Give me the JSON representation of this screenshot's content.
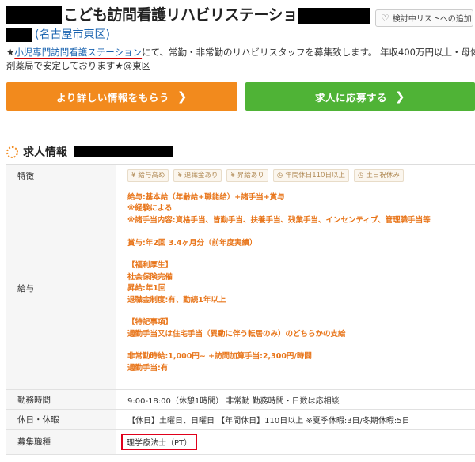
{
  "header": {
    "title": "こども訪問看護リハビリステーション",
    "fav_label": "検討中リストへの追加",
    "location": "(名古屋市東区)"
  },
  "intro": {
    "prefix": "★",
    "highlight": "小児専門訪問看護ステーション",
    "line1_rest": "にて、常勤・非常勤のリハビリスタッフを募集致します。 年収400万円以上・母体は調",
    "line2": "剤薬局で安定しております★@東区"
  },
  "buttons": {
    "info": "より詳しい情報をもらう",
    "apply": "求人に応募する"
  },
  "section": {
    "title": "求人情報"
  },
  "table": {
    "features_label": "特徴",
    "features": [
      {
        "icon": "yen-icon",
        "glyph": "¥",
        "label": "給与高め"
      },
      {
        "icon": "yen-icon",
        "glyph": "¥",
        "label": "退職金あり"
      },
      {
        "icon": "yen-icon",
        "glyph": "¥",
        "label": "昇給あり"
      },
      {
        "icon": "clock-icon",
        "glyph": "◷",
        "label": "年間休日110日以上"
      },
      {
        "icon": "clock-icon",
        "glyph": "◷",
        "label": "土日祝休み"
      }
    ],
    "salary_label": "給与",
    "salary_lines": [
      "給与:基本給（年齢給+職能給）+諸手当+賞与",
      "※経験による",
      "※諸手当内容:資格手当、皆勤手当、扶養手当、残業手当、インセンティブ、管理職手当等",
      "",
      "賞与:年2回 3.4ヶ月分（前年度実績）",
      "",
      "【福利厚生】",
      "社会保険完備",
      "昇給:年1回",
      "退職金制度:有、勤続1年以上",
      "",
      "【特記事項】",
      "通勤手当又は住宅手当（異動に伴う転居のみ）のどちらかの支給",
      "",
      "非常勤時給:1,000円~ +訪問加算手当:2,300円/時間",
      "通勤手当:有"
    ],
    "hours_label": "勤務時間",
    "hours_value": "9:00-18:00（休憩1時間） 非常勤 勤務時間・日数は応相談",
    "holiday_label": "休日・休暇",
    "holiday_value": "【休日】土曜日、日曜日 【年間休日】110日以上 ※夏季休暇:3日/冬期休暇:5日",
    "job_label": "募集職種",
    "job_value": "理学療法士（PT）"
  }
}
